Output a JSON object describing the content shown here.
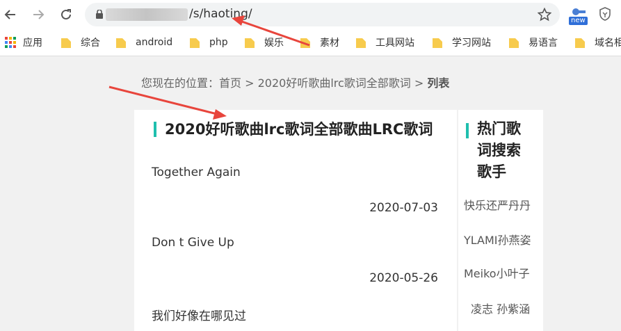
{
  "browser": {
    "url_path": "/s/haoting/",
    "new_badge": "new"
  },
  "bookmarks": [
    {
      "label": "应用",
      "type": "apps"
    },
    {
      "label": "综合",
      "type": "folder"
    },
    {
      "label": "android",
      "type": "folder"
    },
    {
      "label": "php",
      "type": "folder"
    },
    {
      "label": "娱乐",
      "type": "folder"
    },
    {
      "label": "素材",
      "type": "folder"
    },
    {
      "label": "工具网站",
      "type": "folder"
    },
    {
      "label": "学习网站",
      "type": "folder"
    },
    {
      "label": "易语言",
      "type": "folder"
    },
    {
      "label": "域名相",
      "type": "folder"
    }
  ],
  "breadcrumb": {
    "prefix": "您现在的位置：",
    "home": "首页",
    "sep1": " > ",
    "category": "2020好听歌曲lrc歌词全部歌词",
    "sep2": " > ",
    "current": "列表"
  },
  "main": {
    "title": "2020好听歌曲lrc歌词全部歌曲LRC歌词",
    "items": [
      {
        "title": "Together Again",
        "date": "2020-07-03"
      },
      {
        "title": "Don t Give Up",
        "date": "2020-05-26"
      },
      {
        "title": "我们好像在哪见过",
        "date": ""
      }
    ]
  },
  "side": {
    "title": "热门歌词搜索歌手",
    "items": [
      "快乐还严丹丹",
      "YLAMI孙燕姿",
      "Meiko小叶子",
      "凌志 孙紫涵"
    ]
  },
  "colors": {
    "accent": "#1fbfae",
    "arrow": "#e8453c"
  }
}
